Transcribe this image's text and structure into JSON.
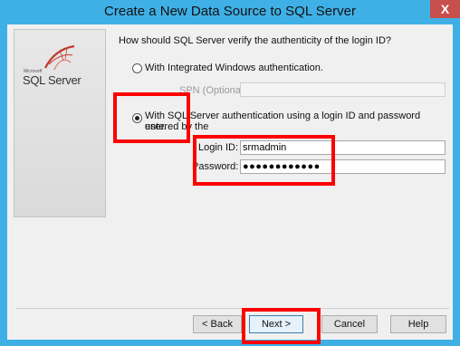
{
  "window": {
    "title": "Create a New Data Source to SQL Server",
    "close_glyph": "X"
  },
  "logo": {
    "small_text": "Microsoft",
    "product": "SQL Server",
    "swoosh_color": "#c0392b"
  },
  "prompt": {
    "question": "How should SQL Server verify the authenticity of the login ID?"
  },
  "auth_options": {
    "windows_label": "With Integrated Windows authentication.",
    "windows_selected": false,
    "spn_label": "SPN (Optional):",
    "spn_value": "",
    "sql_label_line1": "With SQL Server authentication using a login ID and password entered by the",
    "sql_label_line2": "user.",
    "sql_selected": true
  },
  "credentials": {
    "login_label": "Login ID:",
    "login_value": "srmadmin",
    "password_label": "Password:",
    "password_value": "●●●●●●●●●●●●"
  },
  "buttons": {
    "back": "< Back",
    "next": "Next >",
    "cancel": "Cancel",
    "help": "Help"
  },
  "colors": {
    "titlebar": "#3fb0e6",
    "highlight": "#ff0000",
    "close": "#c7504d"
  }
}
